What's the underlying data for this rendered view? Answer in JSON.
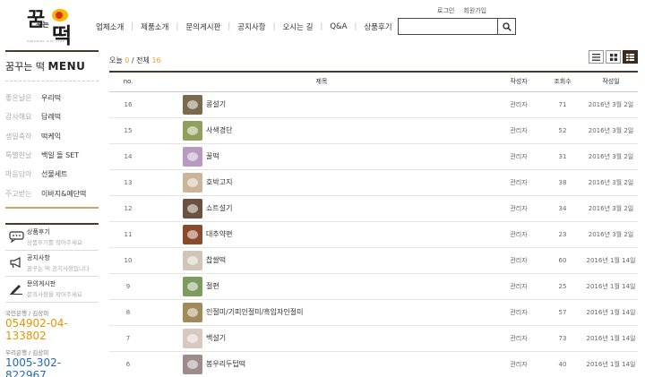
{
  "logo": {
    "line1": "꿈",
    "line2": "꾸는",
    "line3": "떡",
    "sub": "DREAMING RICE CAKE"
  },
  "nav": [
    "업체소개",
    "제품소개",
    "문의게시판",
    "공지사항",
    "오시는 길",
    "Q&A",
    "상품후기"
  ],
  "util": {
    "login": "로그인",
    "join": "회원가입"
  },
  "search": {
    "placeholder": "",
    "icon": "search-icon"
  },
  "sidebar": {
    "title_prefix": "꿈꾸는 떡",
    "title_suffix": "MENU",
    "categories": [
      {
        "tag": "좋은날은",
        "name": "우리떡"
      },
      {
        "tag": "감사해요",
        "name": "답례떡"
      },
      {
        "tag": "생일축하",
        "name": "떡케익"
      },
      {
        "tag": "특별한날",
        "name": "백일 돌 SET"
      },
      {
        "tag": "마음담아",
        "name": "선물세트"
      },
      {
        "tag": "주고받는",
        "name": "이바지&예단떡"
      }
    ],
    "links": [
      {
        "title": "상품후기",
        "desc": "상품후기를 작어주세요",
        "icon": "chat-icon"
      },
      {
        "title": "공지사항",
        "desc": "꿈꾸는 떡 공지사항입니다",
        "icon": "megaphone-icon"
      },
      {
        "title": "문의게시판",
        "desc": "문의사항을 작어주세요",
        "icon": "pencil-icon"
      }
    ],
    "banks": [
      {
        "name": "국민은행 / 김상미",
        "number": "054902-04-133802",
        "color": "#e69500"
      },
      {
        "name": "우리은행 / 김상미",
        "number": "1005-302-822967",
        "color": "#1e6bb8"
      }
    ]
  },
  "board": {
    "today_label": "오늘",
    "today_count": "0",
    "slash": "/",
    "total_label": "전체",
    "total_count": "16",
    "headers": {
      "no": "no.",
      "subject": "제목",
      "author": "작성자",
      "views": "조회수",
      "date": "작성일"
    },
    "rows": [
      {
        "no": "16",
        "subject": "콩설기",
        "author": "관리자",
        "views": "71",
        "date": "2016년 3월 2일",
        "thumb_color": "#7a6a4d"
      },
      {
        "no": "15",
        "subject": "사색경단",
        "author": "관리자",
        "views": "52",
        "date": "2016년 3월 2일",
        "thumb_color": "#8fa05c"
      },
      {
        "no": "14",
        "subject": "꿀떡",
        "author": "관리자",
        "views": "31",
        "date": "2016년 3월 2일",
        "thumb_color": "#b79ac0"
      },
      {
        "no": "13",
        "subject": "호박고지",
        "author": "관리자",
        "views": "38",
        "date": "2016년 3월 2일",
        "thumb_color": "#c9b69a"
      },
      {
        "no": "12",
        "subject": "쇼트설기",
        "author": "관리자",
        "views": "34",
        "date": "2016년 3월 2일",
        "thumb_color": "#6b5240"
      },
      {
        "no": "11",
        "subject": "대추약편",
        "author": "관리자",
        "views": "23",
        "date": "2016년 3월 2일",
        "thumb_color": "#8b4a2e"
      },
      {
        "no": "10",
        "subject": "찹쌀떡",
        "author": "관리자",
        "views": "60",
        "date": "2016년 1월 14일",
        "thumb_color": "#cfc6b8"
      },
      {
        "no": "9",
        "subject": "절편",
        "author": "관리자",
        "views": "25",
        "date": "2016년 1월 14일",
        "thumb_color": "#7d9b5e"
      },
      {
        "no": "8",
        "subject": "인절미/기피인절미/흑임자인절미",
        "author": "관리자",
        "views": "57",
        "date": "2016년 1월 14일",
        "thumb_color": "#a08a5a"
      },
      {
        "no": "7",
        "subject": "백설기",
        "author": "관리자",
        "views": "73",
        "date": "2016년 1월 14일",
        "thumb_color": "#d8c8c0"
      },
      {
        "no": "6",
        "subject": "봉우리두텁떡",
        "author": "관리자",
        "views": "40",
        "date": "2016년 1월 14일",
        "thumb_color": "#9c8c8c"
      }
    ]
  },
  "view_modes": [
    {
      "icon": "list-view-icon",
      "active": false
    },
    {
      "icon": "grid-view-icon",
      "active": false
    },
    {
      "icon": "thumb-list-view-icon",
      "active": true
    }
  ]
}
